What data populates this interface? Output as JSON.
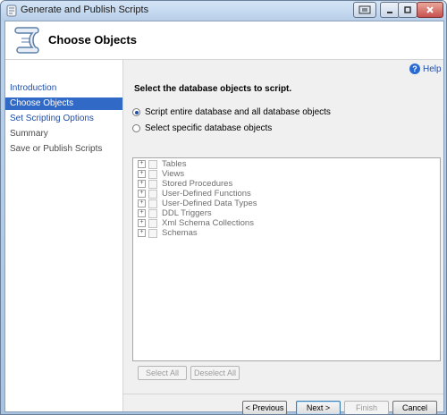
{
  "window": {
    "title": "Generate and Publish Scripts"
  },
  "header": {
    "title": "Choose Objects"
  },
  "sidebar": {
    "items": [
      {
        "label": "Introduction"
      },
      {
        "label": "Choose Objects"
      },
      {
        "label": "Set Scripting Options"
      },
      {
        "label": "Summary"
      },
      {
        "label": "Save or Publish Scripts"
      }
    ]
  },
  "main": {
    "help_label": "Help",
    "instruction": "Select the database objects to script.",
    "options": [
      {
        "label": "Script entire database and all database objects",
        "checked": true
      },
      {
        "label": "Select specific database objects",
        "checked": false
      }
    ],
    "tree": [
      {
        "label": "Tables"
      },
      {
        "label": "Views"
      },
      {
        "label": "Stored Procedures"
      },
      {
        "label": "User-Defined Functions"
      },
      {
        "label": "User-Defined Data Types"
      },
      {
        "label": "DDL Triggers"
      },
      {
        "label": "Xml Schema Collections"
      },
      {
        "label": "Schemas"
      }
    ],
    "select_all": "Select All",
    "deselect_all": "Deselect All"
  },
  "footer": {
    "previous": "< Previous",
    "next": "Next >",
    "finish": "Finish",
    "cancel": "Cancel"
  }
}
